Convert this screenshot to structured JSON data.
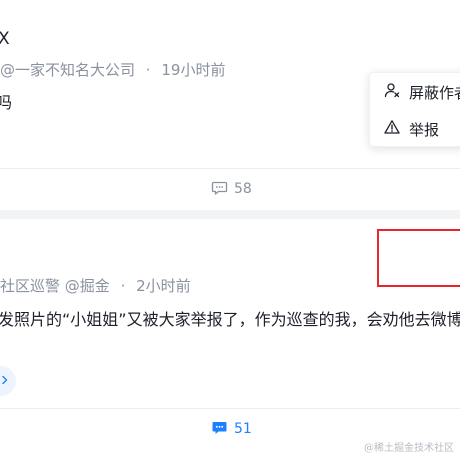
{
  "post1": {
    "title": "X",
    "author": "@一家不知名大公司",
    "separator": "·",
    "time": "19小时前",
    "body": "吗",
    "comment_count": "58"
  },
  "post2": {
    "author": "社区巡警 @掘金",
    "separator": "·",
    "time": "2小时前",
    "body": "发照片的“小姐姐”又被大家举报了，作为巡查的我，会劝他去微博发",
    "comment_count": "51"
  },
  "dropdown": {
    "items": [
      {
        "label": "屏蔽作者",
        "icon": "block-user-icon"
      },
      {
        "label": "举报",
        "icon": "warning-icon"
      }
    ]
  },
  "watermark": "@稀土掘金技术社区",
  "colors": {
    "text_primary": "#1d2129",
    "text_secondary": "#8a919f",
    "accent": "#1e80ff",
    "highlight": "#e8252c"
  }
}
